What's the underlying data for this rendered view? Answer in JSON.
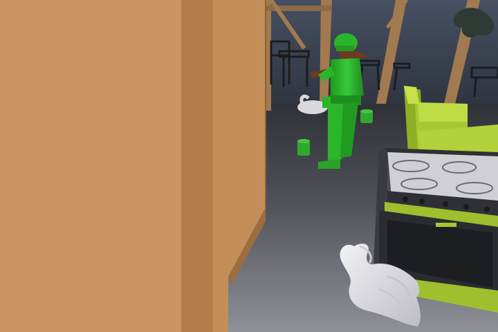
{
  "scene": {
    "type": "3d-first-person-view",
    "setting": "kitchen-interior",
    "objects": [
      {
        "name": "wooden-door-panel",
        "color": "#c9945f"
      },
      {
        "name": "wooden-door-edge",
        "color": "#b47c49"
      },
      {
        "name": "dark-windows",
        "color": "#3b4250"
      },
      {
        "name": "window-frame",
        "color": "#a27a4f"
      },
      {
        "name": "dining-chairs",
        "color": "#1f1f22"
      },
      {
        "name": "green-toy-soldier-figure",
        "color": "#2bb52a"
      },
      {
        "name": "green-cups",
        "color": "#2fa82f"
      },
      {
        "name": "lime-green-armchair",
        "color": "#a7c832"
      },
      {
        "name": "kitchen-stove",
        "color": "#2f3036"
      },
      {
        "name": "stovetop",
        "color": "#cfcfd5"
      },
      {
        "name": "white-swan-statue-foreground",
        "color": "#e8e8ec"
      },
      {
        "name": "white-swan-statue-background",
        "color": "#d9d9de"
      },
      {
        "name": "floor",
        "color": "#6f7079"
      }
    ]
  }
}
